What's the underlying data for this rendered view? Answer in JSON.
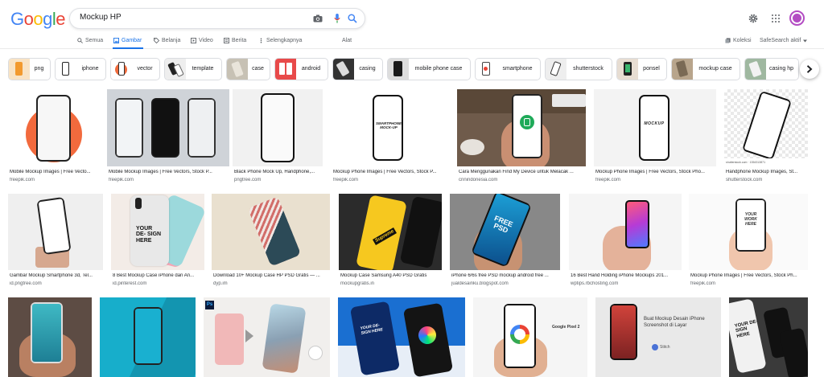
{
  "logo": {
    "letters": [
      "G",
      "o",
      "o",
      "g",
      "l",
      "e"
    ],
    "colors": [
      "#4285f4",
      "#ea4335",
      "#fbbc05",
      "#4285f4",
      "#34a853",
      "#ea4335"
    ]
  },
  "search": {
    "query": "Mockup HP"
  },
  "icons": {
    "camera": "camera-icon",
    "mic": "mic-icon",
    "search": "search-icon",
    "settings": "gear-icon",
    "apps": "apps-grid-icon",
    "avatar": "avatar"
  },
  "nav": {
    "items": [
      {
        "label": "Semua",
        "icon": "search-icon"
      },
      {
        "label": "Gambar",
        "icon": "image-icon",
        "active": true
      },
      {
        "label": "Belanja",
        "icon": "tag-icon"
      },
      {
        "label": "Video",
        "icon": "play-icon"
      },
      {
        "label": "Berita",
        "icon": "news-icon"
      },
      {
        "label": "Selengkapnya",
        "icon": "more-icon"
      }
    ],
    "tools": "Alat",
    "collections": "Koleksi",
    "safesearch": "SafeSearch aktif"
  },
  "chips": [
    {
      "label": "png"
    },
    {
      "label": "iphone"
    },
    {
      "label": "vector"
    },
    {
      "label": "template"
    },
    {
      "label": "case"
    },
    {
      "label": "android"
    },
    {
      "label": "casing"
    },
    {
      "label": "mobile phone case"
    },
    {
      "label": "smartphone"
    },
    {
      "label": "shutterstock"
    },
    {
      "label": "ponsel"
    },
    {
      "label": "mockup case"
    },
    {
      "label": "casing hp"
    }
  ],
  "results": {
    "row1": [
      {
        "title": "Mobile Mockup Images | Free Vecto...",
        "source": "freepik.com"
      },
      {
        "title": "Mobile Mockup Images | Free Vectors, Stock P...",
        "source": "freepik.com"
      },
      {
        "title": "Black Phone Mock Up, Handphone,...",
        "source": "pngtree.com"
      },
      {
        "title": "Mockup Phone Images | Free Vectors, Stock P...",
        "source": "freepik.com"
      },
      {
        "title": "Cara Menggunakan Find My Device untuk Melacak ...",
        "source": "cnnindonesia.com"
      },
      {
        "title": "Mockup Phone Images | Free Vectors, Stock Pho...",
        "source": "freepik.com"
      },
      {
        "title": "Handphone Mockup Images, St...",
        "source": "shutterstock.com"
      }
    ],
    "row2": [
      {
        "title": "Gambar Mockup Smartphone 3d, Tel...",
        "source": "id.pngtree.com"
      },
      {
        "title": "8 Best Mockup Case iPhone dan An...",
        "source": "id.pinterest.com"
      },
      {
        "title": "Download 10+ Mockup Case HP PSD Gratis — ...",
        "source": "dyp.im"
      },
      {
        "title": "Mockup Case Samsung A40 PSD Gratis",
        "source": "mockupgratis.in"
      },
      {
        "title": "iPhone 6/6s free PSD mockup android free ...",
        "source": "jualdesainku.blogspot.com"
      },
      {
        "title": "16 Best Hand Holding iPhone Mockups 201...",
        "source": "wptips.rbchosting.com"
      },
      {
        "title": "Mockup Phone Images | Free Vectors, Stock Ph...",
        "source": "freepik.com"
      }
    ]
  },
  "image_text": {
    "smartphone_mockup": "SMARTPHONE MOCK-UP",
    "mockup": "MOCKUP",
    "your_design_here": "YOUR DE- SIGN HERE",
    "supreme": "Supreme",
    "free_psd": "FREE PSD",
    "your_work_here": "YOUR WORK HERE",
    "google_pixel": "Google Pixel 2",
    "buat_mockup": "Buat Mockup Desain iPhone Screenshot di Layar",
    "stitch": "Stitch",
    "ps": "Ps",
    "shutterstock_id": "shutterstock.com · 1354313871",
    "your_design_here_2": "YOUR DE- SIGN HERE"
  }
}
